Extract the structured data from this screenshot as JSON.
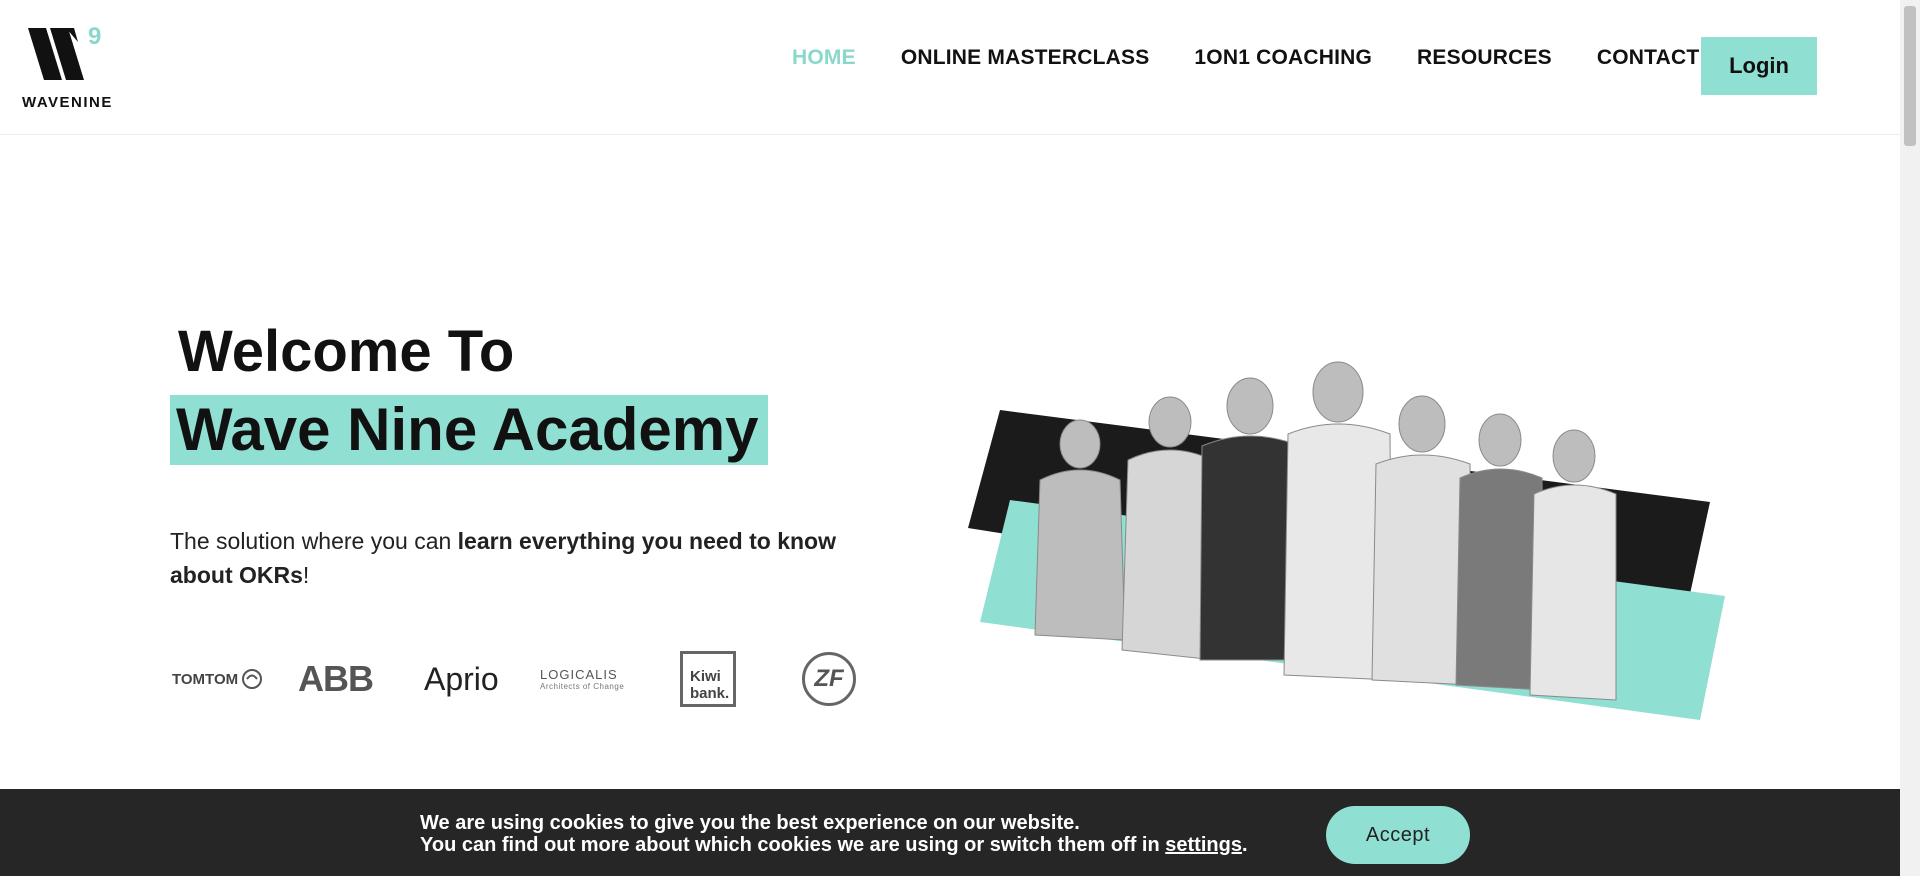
{
  "brand": {
    "logo_text": "WAVENINE",
    "accent_color": "#8fdfd2"
  },
  "nav": {
    "items": [
      {
        "label": "HOME",
        "active": true
      },
      {
        "label": "ONLINE MASTERCLASS"
      },
      {
        "label": "1ON1 COACHING"
      },
      {
        "label": "RESOURCES"
      },
      {
        "label": "CONTACT"
      }
    ],
    "login_label": "Login"
  },
  "hero": {
    "title_line1": "Welcome To",
    "title_line2": "Wave Nine Academy",
    "desc_prefix": "The solution where you can ",
    "desc_bold": "learn everything you need to know about OKRs",
    "desc_suffix": "!"
  },
  "client_logos": {
    "tomtom": "TOMTOM",
    "abb": "ABB",
    "aprio": "Aprio",
    "logicalis": "LOGICALIS",
    "logicalis_tagline": "Architects of Change",
    "kiwibank_line1": "Kiwi",
    "kiwibank_line2": "bank.",
    "zf": "ZF"
  },
  "cookie": {
    "line1": "We are using cookies to give you the best experience on our website.",
    "line2_prefix": "You can find out more about which cookies we are using or switch them off in ",
    "line2_link": "settings",
    "line2_suffix": ".",
    "accept_label": "Accept"
  }
}
